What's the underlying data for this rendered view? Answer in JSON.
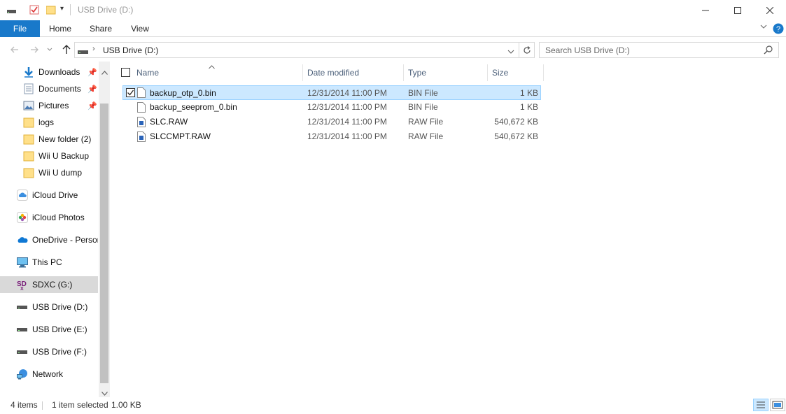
{
  "window": {
    "title": "USB Drive (D:)"
  },
  "ribbon": {
    "tabs": [
      "File",
      "Home",
      "Share",
      "View"
    ]
  },
  "address": {
    "path": "USB Drive (D:)",
    "search_placeholder": "Search USB Drive (D:)"
  },
  "nav": {
    "items": [
      {
        "label": "Downloads",
        "icon": "download-arrow-icon",
        "pinned": true
      },
      {
        "label": "Documents",
        "icon": "document-icon",
        "pinned": true
      },
      {
        "label": "Pictures",
        "icon": "pictures-icon",
        "pinned": true
      },
      {
        "label": "logs",
        "icon": "folder-icon"
      },
      {
        "label": "New folder (2)",
        "icon": "folder-icon"
      },
      {
        "label": "Wii U Backup",
        "icon": "folder-icon"
      },
      {
        "label": "Wii U dump",
        "icon": "folder-icon"
      },
      {
        "label": "iCloud Drive",
        "icon": "icloud-drive-icon"
      },
      {
        "label": "iCloud Photos",
        "icon": "icloud-photos-icon"
      },
      {
        "label": "OneDrive - Persor",
        "icon": "onedrive-icon"
      },
      {
        "label": "This PC",
        "icon": "computer-icon"
      },
      {
        "label": "SDXC (G:)",
        "icon": "sd-card-icon"
      },
      {
        "label": "USB Drive (D:)",
        "icon": "usb-drive-icon"
      },
      {
        "label": "USB Drive (E:)",
        "icon": "usb-drive-icon"
      },
      {
        "label": "USB Drive (F:)",
        "icon": "usb-drive-icon"
      },
      {
        "label": "Network",
        "icon": "network-icon"
      }
    ],
    "selected": "SDXC (G:)"
  },
  "files": {
    "columns": [
      "Name",
      "Date modified",
      "Type",
      "Size"
    ],
    "rows": [
      {
        "name": "backup_otp_0.bin",
        "date": "12/31/2014 11:00 PM",
        "type": "BIN File",
        "size": "1 KB",
        "selected": true
      },
      {
        "name": "backup_seeprom_0.bin",
        "date": "12/31/2014 11:00 PM",
        "type": "BIN File",
        "size": "1 KB"
      },
      {
        "name": "SLC.RAW",
        "date": "12/31/2014 11:00 PM",
        "type": "RAW File",
        "size": "540,672 KB"
      },
      {
        "name": "SLCCMPT.RAW",
        "date": "12/31/2014 11:00 PM",
        "type": "RAW File",
        "size": "540,672 KB"
      }
    ]
  },
  "status": {
    "item_count": "4 items",
    "selection": "1 item selected",
    "selection_size": "1.00 KB"
  },
  "colors": {
    "accent": "#1979ca",
    "selection_bg": "#cce8ff",
    "selection_border": "#99d1ff"
  }
}
